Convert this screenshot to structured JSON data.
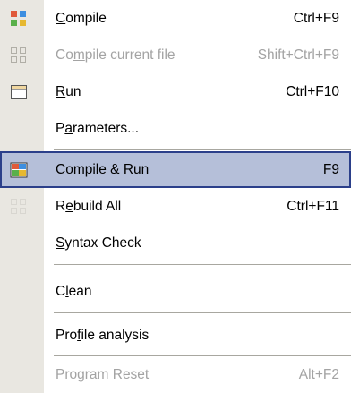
{
  "menu": {
    "items": [
      {
        "pre": "",
        "u": "C",
        "post": "ompile",
        "shortcut": "Ctrl+F9",
        "icon": "compile-icon",
        "disabled": false
      },
      {
        "pre": "Co",
        "u": "m",
        "post": "pile current file",
        "shortcut": "Shift+Ctrl+F9",
        "icon": "compile-current-file-icon",
        "disabled": true
      },
      {
        "pre": "",
        "u": "R",
        "post": "un",
        "shortcut": "Ctrl+F10",
        "icon": "run-window-icon",
        "disabled": false
      },
      {
        "pre": "P",
        "u": "a",
        "post": "rameters...",
        "shortcut": "",
        "icon": "",
        "disabled": false
      },
      {
        "pre": "C",
        "u": "o",
        "post": "mpile & Run",
        "shortcut": "F9",
        "icon": "compile-run-icon",
        "disabled": false,
        "selected": true
      },
      {
        "pre": "R",
        "u": "e",
        "post": "build All",
        "shortcut": "Ctrl+F11",
        "icon": "rebuild-all-icon",
        "disabled": false
      },
      {
        "pre": "",
        "u": "S",
        "post": "yntax Check",
        "shortcut": "",
        "icon": "",
        "disabled": false
      },
      {
        "pre": "C",
        "u": "l",
        "post": "ean",
        "shortcut": "",
        "icon": "",
        "disabled": false
      },
      {
        "pre": "Pro",
        "u": "f",
        "post": "ile analysis",
        "shortcut": "",
        "icon": "",
        "disabled": false
      },
      {
        "pre": "",
        "u": "P",
        "post": "rogram Reset",
        "shortcut": "Alt+F2",
        "icon": "",
        "disabled": true
      }
    ]
  },
  "colors": {
    "gutter": "#e9e7e1",
    "highlight": "#b5bfd9",
    "highlight_border": "#2b3f8a",
    "disabled_text": "#a3a3a3"
  }
}
